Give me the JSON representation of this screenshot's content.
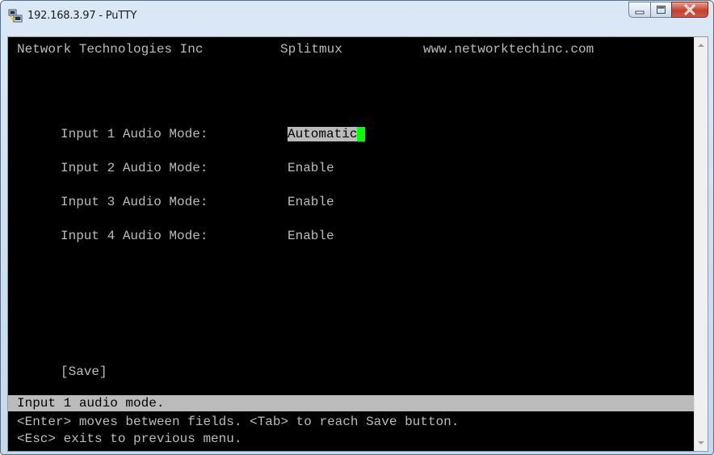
{
  "window": {
    "title": "192.168.3.97 - PuTTY",
    "controls": [
      "minimize-icon",
      "maximize-icon",
      "close-icon"
    ]
  },
  "terminal": {
    "header_company": "Network Technologies Inc",
    "header_product": "Splitmux",
    "header_url": "www.networktechinc.com",
    "fields": [
      {
        "label": "Input 1 Audio Mode:",
        "value": "Automatic"
      },
      {
        "label": "Input 2 Audio Mode:",
        "value": "Enable"
      },
      {
        "label": "Input 3 Audio Mode:",
        "value": "Enable"
      },
      {
        "label": "Input 4 Audio Mode:",
        "value": "Enable"
      }
    ],
    "save_button": "[Save]",
    "status_line": "Input 1 audio mode.",
    "help_lines": [
      "<Enter> moves between fields. <Tab> to reach Save button.",
      "<Esc> exits to previous menu."
    ]
  },
  "colors": {
    "terminal_bg": "#000000",
    "terminal_fg": "#bbbbbb",
    "cursor": "#00ff00",
    "highlight_bg": "#bbbbbb"
  }
}
